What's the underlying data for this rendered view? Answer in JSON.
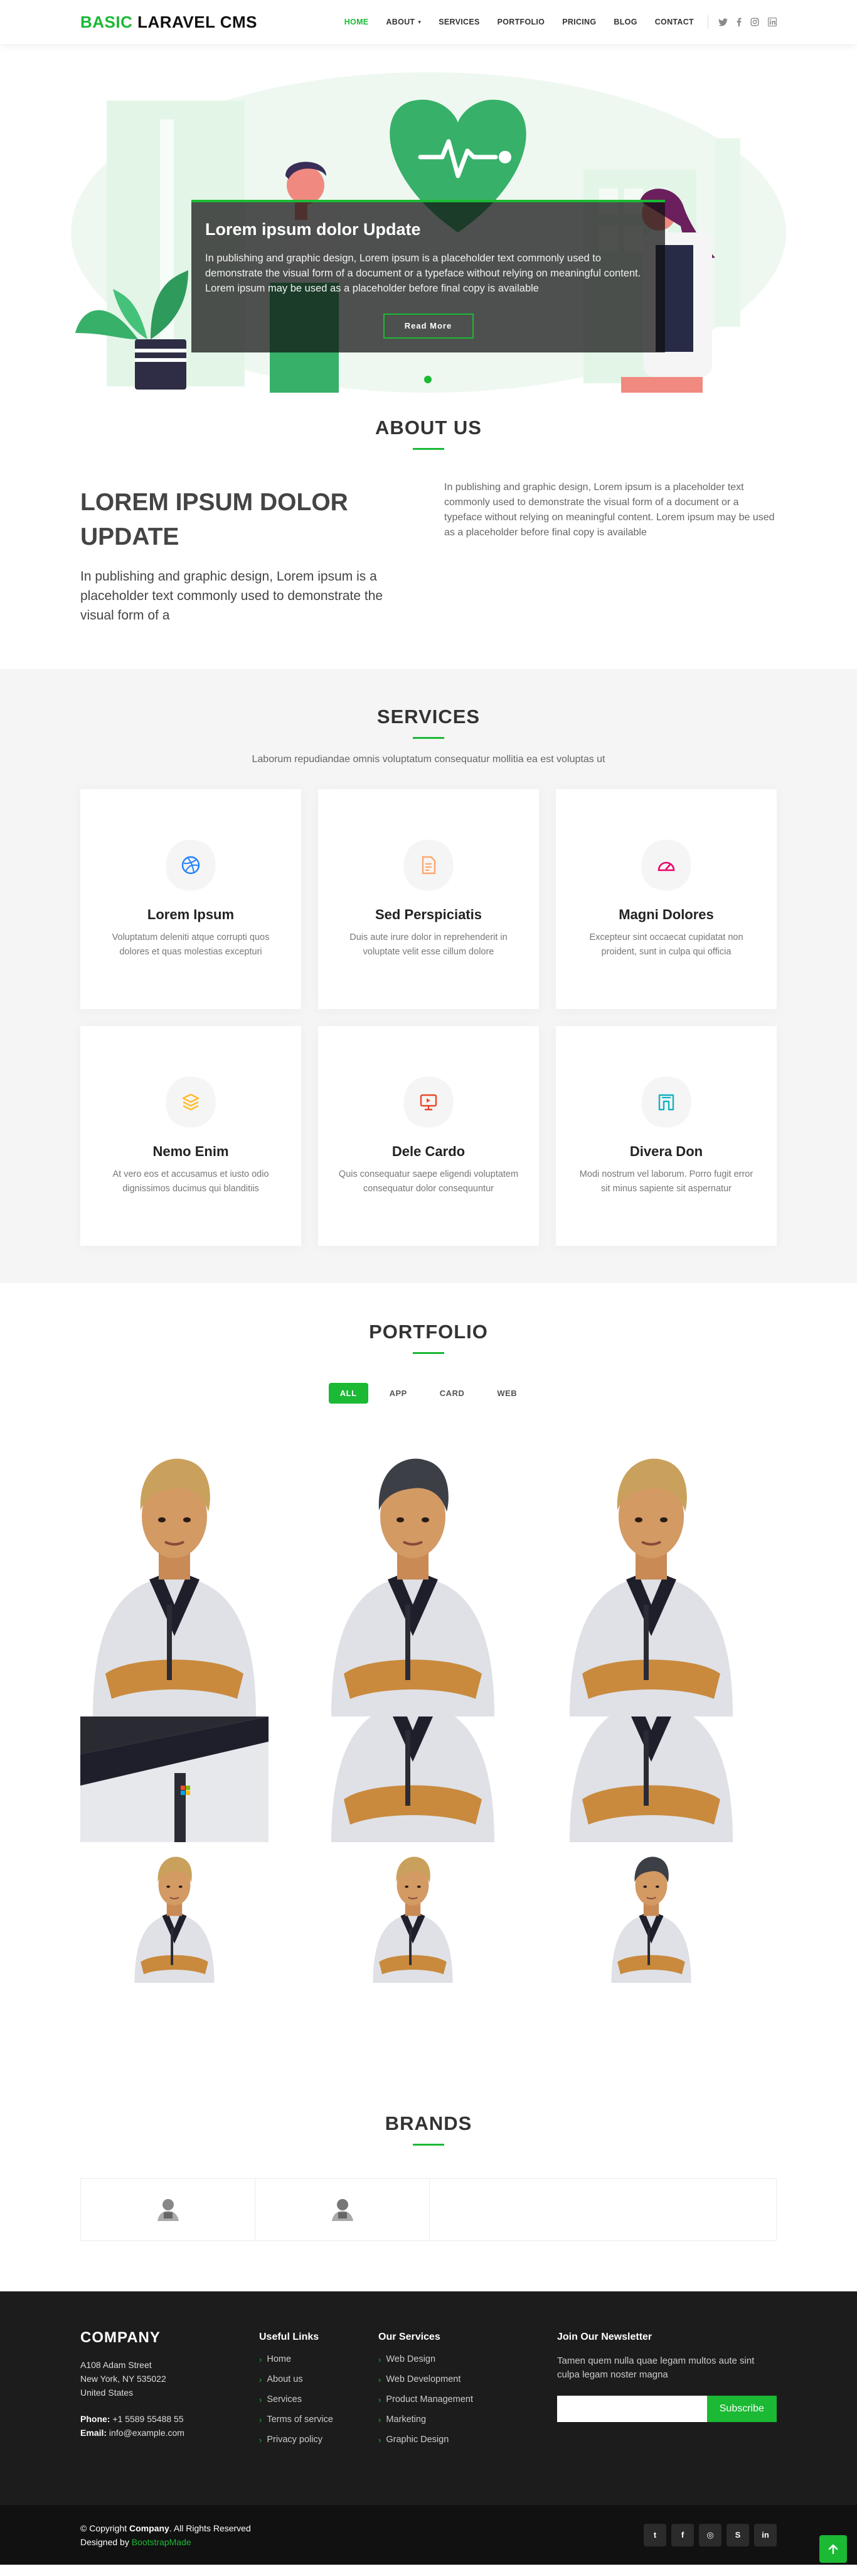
{
  "header": {
    "logo_accent": "BASIC",
    "logo_rest": " LARAVEL CMS",
    "nav": [
      {
        "label": "HOME"
      },
      {
        "label": "ABOUT"
      },
      {
        "label": "SERVICES"
      },
      {
        "label": "PORTFOLIO"
      },
      {
        "label": "PRICING"
      },
      {
        "label": "BLOG"
      },
      {
        "label": "CONTACT"
      }
    ],
    "social_icons": [
      "twitter-icon",
      "facebook-icon",
      "instagram-icon",
      "linkedin-icon"
    ]
  },
  "hero": {
    "title": "Lorem ipsum dolor Update",
    "text": "In publishing and graphic design, Lorem ipsum is a placeholder text commonly used to demonstrate the visual form of a document or a typeface without relying on meaningful content. Lorem ipsum may be used as a placeholder before final copy is available",
    "button": "Read More"
  },
  "about": {
    "title": "ABOUT US",
    "heading": "LOREM IPSUM DOLOR UPDATE",
    "lead": "In publishing and graphic design, Lorem ipsum is a placeholder text commonly used to demonstrate the visual form of a",
    "text": "In publishing and graphic design, Lorem ipsum is a placeholder text commonly used to demonstrate the visual form of a document or a typeface without relying on meaningful content. Lorem ipsum may be used as a placeholder before final copy is available"
  },
  "services": {
    "title": "SERVICES",
    "subtitle": "Laborum repudiandae omnis voluptatum consequatur mollitia ea est voluptas ut",
    "items": [
      {
        "title": "Lorem Ipsum",
        "text": "Voluptatum deleniti atque corrupti quos dolores et quas molestias excepturi",
        "icon": "dribbble-icon",
        "color": "#2282ff"
      },
      {
        "title": "Sed Perspiciatis",
        "text": "Duis aute irure dolor in reprehenderit in voluptate velit esse cillum dolore",
        "icon": "file-icon",
        "color": "#ffa76e"
      },
      {
        "title": "Magni Dolores",
        "text": "Excepteur sint occaecat cupidatat non proident, sunt in culpa qui officia",
        "icon": "tachometer-icon",
        "color": "#e80368"
      },
      {
        "title": "Nemo Enim",
        "text": "At vero eos et accusamus et iusto odio dignissimos ducimus qui blanditiis",
        "icon": "layers-icon",
        "color": "#ffbb2c"
      },
      {
        "title": "Dele Cardo",
        "text": "Quis consequatur saepe eligendi voluptatem consequatur dolor consequuntur",
        "icon": "slideshow-icon",
        "color": "#d6ff22"
      },
      {
        "title": "Divera Don",
        "text": "Modi nostrum vel laborum. Porro fugit error sit minus sapiente sit aspernatur",
        "icon": "arch-icon",
        "color": "#4233ff"
      }
    ]
  },
  "portfolio": {
    "title": "PORTFOLIO",
    "filters": [
      "ALL",
      "APP",
      "CARD",
      "WEB"
    ]
  },
  "brands": {
    "title": "BRANDS"
  },
  "footer": {
    "company": "COMPANY",
    "address1": "A108 Adam Street",
    "address2": "New York, NY 535022",
    "address3": "United States",
    "phone_label": "Phone:",
    "phone": " +1 5589 55488 55",
    "email_label": "Email:",
    "email": " info@example.com",
    "useful_title": "Useful Links",
    "useful": [
      "Home",
      "About us",
      "Services",
      "Terms of service",
      "Privacy policy"
    ],
    "services_title": "Our Services",
    "services": [
      "Web Design",
      "Web Development",
      "Product Management",
      "Marketing",
      "Graphic Design"
    ],
    "news_title": "Join Our Newsletter",
    "news_text": "Tamen quem nulla quae legam multos aute sint culpa legam noster magna",
    "subscribe": "Subscribe",
    "copy_prefix": "© Copyright ",
    "copy_company": "Company",
    "copy_suffix": ". All Rights Reserved",
    "designed_prefix": "Designed by ",
    "designed_by": "BootstrapMade",
    "social": [
      "t",
      "f",
      "◎",
      "S",
      "in"
    ]
  },
  "colors": {
    "accent": "#1bb934",
    "dark": "#1c1c1c"
  }
}
